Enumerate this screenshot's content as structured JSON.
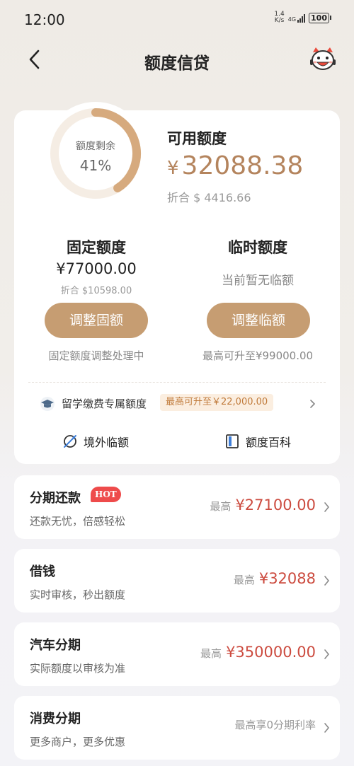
{
  "status_bar": {
    "time": "12:00",
    "net_speed_value": "1.4",
    "net_speed_unit": "K/s",
    "net_type": "4G",
    "battery": "100"
  },
  "header": {
    "title": "额度信贷",
    "back_icon": "chevron-left-icon",
    "mascot_icon": "mascot-icon"
  },
  "summary": {
    "ring_label": "额度剩余",
    "ring_value": "41%",
    "ring_fraction": 0.41,
    "available_title": "可用额度",
    "available_currency": "¥",
    "available_amount": "32088.38",
    "available_equiv": "折合 $ 4416.66"
  },
  "fixed": {
    "title": "固定额度",
    "amount": "¥77000.00",
    "equiv": "折合 $10598.00",
    "button": "调整固额",
    "status": "固定额度调整处理中"
  },
  "temporary": {
    "title": "临时额度",
    "note": "当前暂无临额",
    "button": "调整临额",
    "status": "最高可升至¥99000.00"
  },
  "study": {
    "label": "留学缴费专属额度",
    "tag": "最高可升至￥22,000.00"
  },
  "links": {
    "overseas": "境外临额",
    "encyclopedia": "额度百科"
  },
  "products": [
    {
      "title": "分期还款",
      "badge": "HOT",
      "subtitle": "还款无忧，倍感轻松",
      "prefix": "最高",
      "amount": "¥27100.00"
    },
    {
      "title": "借钱",
      "subtitle": "实时审核，秒出额度",
      "prefix": "最高",
      "amount": "¥32088"
    },
    {
      "title": "汽车分期",
      "subtitle": "实际额度以审核为准",
      "prefix": "最高",
      "amount": "¥350000.00"
    },
    {
      "title": "消费分期",
      "subtitle": "更多商户，更多优惠",
      "plain": "最高享0分期利率"
    }
  ],
  "colors": {
    "accent_gold": "#c69d72",
    "amount_gold": "#b4845d",
    "amount_red": "#cc4b3f",
    "hot_red": "#ee4b4b"
  }
}
